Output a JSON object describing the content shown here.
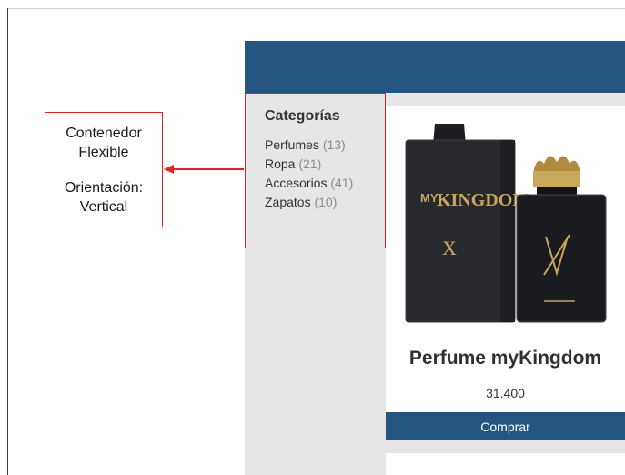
{
  "annotation": {
    "line1": "Contenedor",
    "line2": "Flexible",
    "line3": "Orientación:",
    "line4": "Vertical",
    "color": "#e02424"
  },
  "sidebar": {
    "title": "Categorías",
    "items": [
      {
        "label": "Perfumes",
        "count": "(13)"
      },
      {
        "label": "Ropa",
        "count": "(21)"
      },
      {
        "label": "Accesorios",
        "count": "(41)"
      },
      {
        "label": "Zapatos",
        "count": "(10)"
      }
    ]
  },
  "product": {
    "name": "Perfume myKingdom",
    "price": "31.400",
    "buy_label": "Comprar",
    "image_icon": "perfume-bottle-icon"
  },
  "colors": {
    "header": "#255681",
    "sidebar_bg": "#e6e6e6",
    "highlight": "#e02424"
  }
}
